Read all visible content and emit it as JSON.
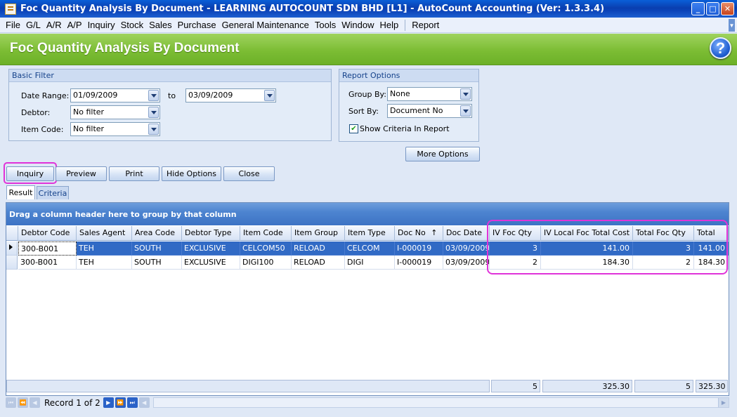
{
  "window": {
    "title": "Foc Quantity Analysis By Document - LEARNING AUTOCOUNT SDN BHD [L1] - AutoCount Accounting (Ver: 1.3.3.4)",
    "minimize": "_",
    "maximize": "□",
    "close": "✕"
  },
  "menu": [
    "File",
    "G/L",
    "A/R",
    "A/P",
    "Inquiry",
    "Stock",
    "Sales",
    "Purchase",
    "General Maintenance",
    "Tools",
    "Window",
    "Help",
    "Report"
  ],
  "banner": {
    "title": "Foc Quantity Analysis By Document",
    "help": "?"
  },
  "basic_filter": {
    "title": "Basic Filter",
    "date_range_label": "Date Range:",
    "date_from": "01/09/2009",
    "to_label": "to",
    "date_to": "03/09/2009",
    "debtor_label": "Debtor:",
    "debtor_value": "No filter",
    "item_code_label": "Item Code:",
    "item_code_value": "No filter"
  },
  "report_options": {
    "title": "Report Options",
    "group_by_label": "Group By:",
    "group_by_value": "None",
    "sort_by_label": "Sort By:",
    "sort_by_value": "Document No",
    "show_criteria_label": "Show Criteria In Report",
    "show_criteria_checked": true
  },
  "buttons": {
    "more_options": "More Options",
    "inquiry": "Inquiry",
    "preview": "Preview",
    "print": "Print",
    "hide_options": "Hide Options",
    "close": "Close"
  },
  "tabs": [
    "Result",
    "Criteria"
  ],
  "grid": {
    "group_panel_text": "Drag a column header here to group by that column",
    "columns": [
      "Debtor Code",
      "Sales Agent",
      "Area Code",
      "Debtor Type",
      "Item Code",
      "Item Group",
      "Item Type",
      "Doc No",
      "Doc Date",
      "IV Foc Qty",
      "IV Local Foc Total Cost",
      "Total Foc Qty",
      "Total"
    ],
    "sort_indicator": "↑",
    "rows": [
      [
        "300-B001",
        "TEH",
        "SOUTH",
        "EXCLUSIVE",
        "CELCOM50",
        "RELOAD",
        "CELCOM",
        "I-000019",
        "03/09/2009",
        "3",
        "141.00",
        "3",
        "141.00"
      ],
      [
        "300-B001",
        "TEH",
        "SOUTH",
        "EXCLUSIVE",
        "DIGI100",
        "RELOAD",
        "DIGI",
        "I-000019",
        "03/09/2009",
        "2",
        "184.30",
        "2",
        "184.30"
      ]
    ],
    "totals": {
      "iv_foc_qty": "5",
      "iv_local_foc_total_cost": "325.30",
      "total_foc_qty": "5",
      "total": "325.30"
    }
  },
  "navigator": {
    "record_text": "Record 1 of 2"
  },
  "colors": {
    "highlight": "#e033d9",
    "banner_green": "#7cbd34",
    "selection_blue": "#316ac5"
  }
}
